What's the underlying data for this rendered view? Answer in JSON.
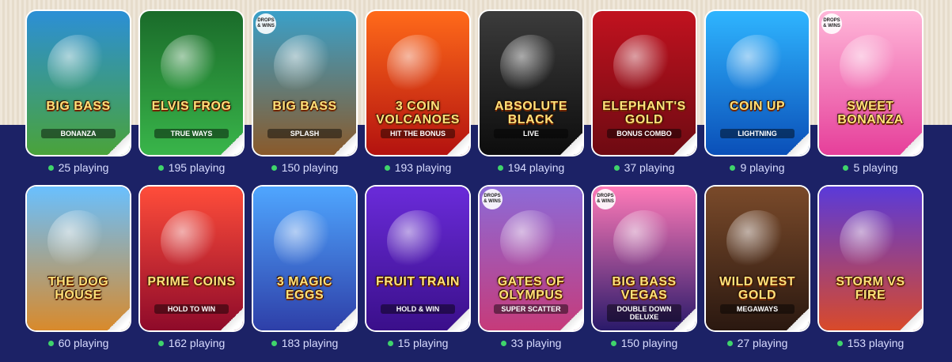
{
  "live_dot_color": "#3fd46b",
  "games": [
    {
      "title": "Big Bass",
      "subtitle": "Bonanza",
      "badge": "",
      "playing": "25 playing",
      "bg": [
        "#2c8fd6",
        "#4aa33a"
      ]
    },
    {
      "title": "Elvis Frog",
      "subtitle": "True Ways",
      "badge": "",
      "playing": "195 playing",
      "bg": [
        "#1a6b2a",
        "#39b54a"
      ]
    },
    {
      "title": "Big Bass",
      "subtitle": "Splash",
      "badge": "DROPS & WINS",
      "playing": "150 playing",
      "bg": [
        "#3aa0c9",
        "#8a5a2b"
      ]
    },
    {
      "title": "3 Coin Volcanoes",
      "subtitle": "Hit the Bonus",
      "badge": "",
      "playing": "193 playing",
      "bg": [
        "#ff6a1a",
        "#b3120f"
      ]
    },
    {
      "title": "Absolute Black",
      "subtitle": "Live",
      "badge": "",
      "playing": "194 playing",
      "bg": [
        "#3b3b3b",
        "#0d0d0d"
      ]
    },
    {
      "title": "Elephant's Gold",
      "subtitle": "Bonus Combo",
      "badge": "",
      "playing": "37 playing",
      "bg": [
        "#c1121f",
        "#6e0a12"
      ]
    },
    {
      "title": "Coin Up",
      "subtitle": "Lightning",
      "badge": "",
      "playing": "9 playing",
      "bg": [
        "#2fb5ff",
        "#0a4fb8"
      ]
    },
    {
      "title": "Sweet Bonanza",
      "subtitle": "",
      "badge": "DROPS & WINS",
      "playing": "5 playing",
      "bg": [
        "#ffb7d9",
        "#e63f9a"
      ]
    },
    {
      "title": "The Dog House",
      "subtitle": "",
      "badge": "",
      "playing": "60 playing",
      "bg": [
        "#69c0ff",
        "#d98a2b"
      ]
    },
    {
      "title": "Prime Coins",
      "subtitle": "Hold to Win",
      "badge": "",
      "playing": "162 playing",
      "bg": [
        "#ff4d3a",
        "#8e0a2a"
      ]
    },
    {
      "title": "3 Magic Eggs",
      "subtitle": "",
      "badge": "",
      "playing": "183 playing",
      "bg": [
        "#4fa6ff",
        "#2e3fa8"
      ]
    },
    {
      "title": "Fruit Train",
      "subtitle": "Hold & Win",
      "badge": "",
      "playing": "15 playing",
      "bg": [
        "#6a2bd9",
        "#3a0f8a"
      ]
    },
    {
      "title": "Gates of Olympus",
      "subtitle": "Super Scatter",
      "badge": "DROPS & WINS",
      "playing": "33 playing",
      "bg": [
        "#8c6ad8",
        "#c63b7a"
      ]
    },
    {
      "title": "Big Bass Vegas",
      "subtitle": "Double Down Deluxe",
      "badge": "DROPS & WINS",
      "playing": "150 playing",
      "bg": [
        "#ff7ab8",
        "#2a1a6a"
      ]
    },
    {
      "title": "Wild West Gold",
      "subtitle": "Megaways",
      "badge": "",
      "playing": "27 playing",
      "bg": [
        "#7a4a2a",
        "#2a1810"
      ]
    },
    {
      "title": "Storm vs Fire",
      "subtitle": "",
      "badge": "",
      "playing": "153 playing",
      "bg": [
        "#5a3ad9",
        "#d94a2a"
      ]
    }
  ]
}
